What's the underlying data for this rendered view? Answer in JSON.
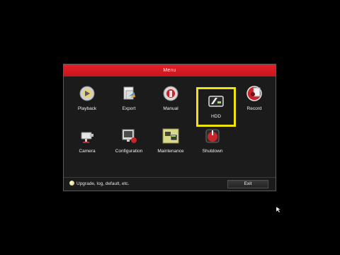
{
  "menu": {
    "title": "Menu",
    "items": [
      {
        "label": "Playback",
        "icon": "playback-icon"
      },
      {
        "label": "Export",
        "icon": "export-icon"
      },
      {
        "label": "Manual",
        "icon": "manual-icon"
      },
      {
        "label": "HDD",
        "icon": "hdd-icon",
        "selected": true
      },
      {
        "label": "Record",
        "icon": "record-icon"
      },
      {
        "label": "Camera",
        "icon": "camera-icon"
      },
      {
        "label": "Configuration",
        "icon": "configuration-icon"
      },
      {
        "label": "Maintenance",
        "icon": "maintenance-icon"
      },
      {
        "label": "Shutdown",
        "icon": "shutdown-icon"
      }
    ],
    "hint": "Upgrade, log, default, etc.",
    "exit_label": "Exit"
  },
  "colors": {
    "title_bar": "#d81c22",
    "selection": "#f0e30c",
    "panel": "#1b1b1b"
  }
}
